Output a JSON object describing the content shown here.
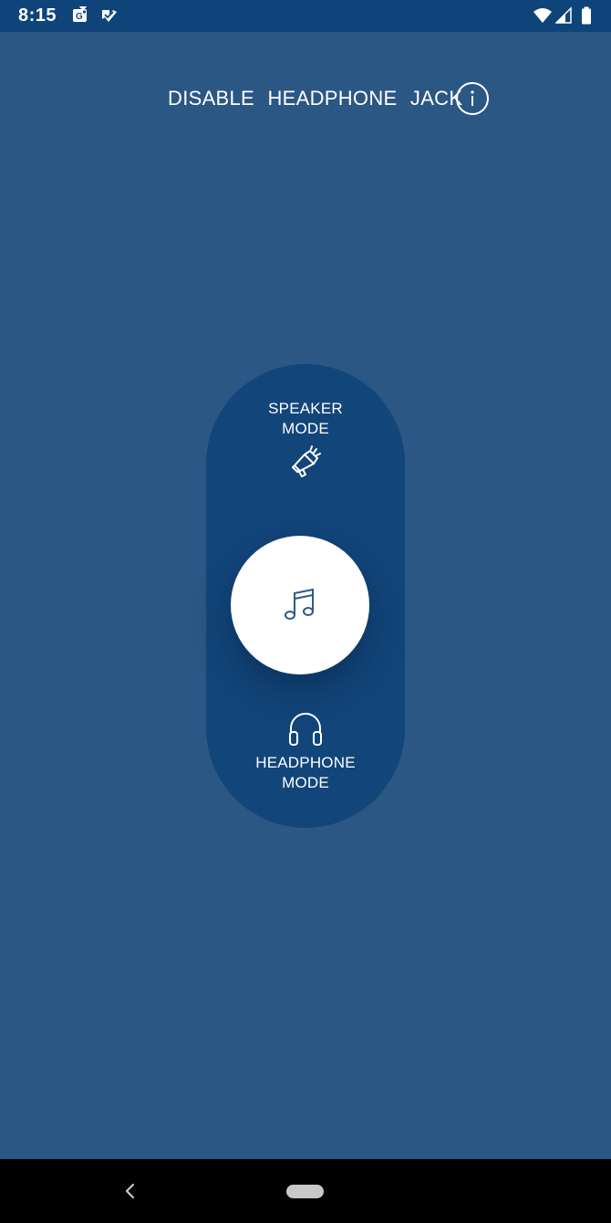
{
  "status_bar": {
    "time": "8:15",
    "left_icons": [
      "maps-notification-icon",
      "task-check-icon"
    ],
    "right_icons": [
      "wifi-icon",
      "cell-signal-icon",
      "battery-icon"
    ]
  },
  "header": {
    "title": "DISABLE HEADPHONE JACK",
    "info_icon": "info-icon"
  },
  "toggle": {
    "speaker_label_line1": "SPEAKER",
    "speaker_label_line2": "MODE",
    "speaker_icon": "megaphone-icon",
    "knob_icon": "music-note-icon",
    "headphone_icon": "headphones-icon",
    "headphone_label_line1": "HEADPHONE",
    "headphone_label_line2": "MODE"
  },
  "nav_bar": {
    "back_icon": "back-chevron-icon",
    "home_icon": "home-pill-icon"
  },
  "colors": {
    "background": "#2b5784",
    "status_bar": "#0f447a",
    "toggle_track": "#12457a",
    "knob": "#ffffff",
    "accent_icon": "#2d5c8a"
  }
}
